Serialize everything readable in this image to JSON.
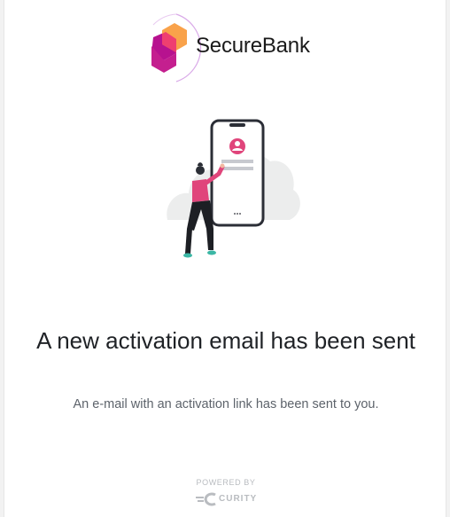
{
  "brand": {
    "name": "SecureBank",
    "logo_icon": "securebank-hexagon-logo",
    "colors": {
      "hex_light": "#f9a24a",
      "hex_mid": "#ef3f70",
      "hex_dark": "#b7128f",
      "arc": "#d9a9e8"
    }
  },
  "illustration": {
    "icon": "person-with-phone-illustration",
    "colors": {
      "shirt": "#e0457b",
      "phone_outline": "#2b2e36",
      "avatar": "#e0457b",
      "bars": "#c7c9cf",
      "shoes": "#3bb7a5",
      "cloud": "#eceded"
    }
  },
  "message": {
    "heading": "A new activation email has been sent",
    "body": "An e-mail with an activation link has been sent to you."
  },
  "footer": {
    "powered_by": "POWERED BY",
    "vendor": "CURITY",
    "vendor_icon": "curity-logo-icon"
  }
}
